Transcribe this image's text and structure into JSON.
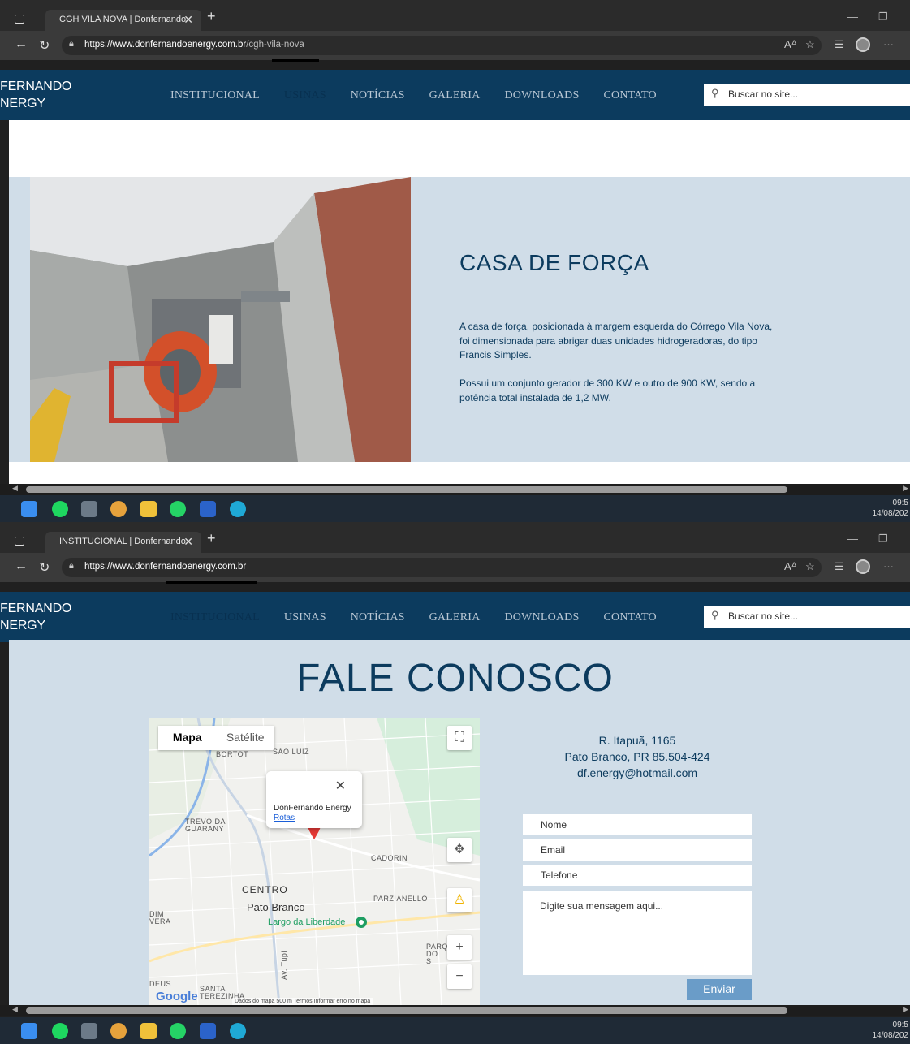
{
  "screen1": {
    "tab_title": "CGH VILA NOVA | Donfernando",
    "url_host": "https://www.donfernandoenergy.com.br",
    "url_path": "/cgh-vila-nova",
    "site": {
      "logo_line1": "FERNANDO",
      "logo_line2": "NERGY",
      "menu": [
        "INSTITUCIONAL",
        "USINAS",
        "NOTÍCIAS",
        "GALERIA",
        "DOWNLOADS",
        "CONTATO"
      ],
      "active_menu": "USINAS",
      "search_placeholder": "Buscar no site..."
    },
    "section": {
      "title": "CASA DE FORÇA",
      "paragraph1": "A casa de força, posicionada à margem esquerda do Córrego Vila Nova, foi dimensionada para abrigar duas unidades hidrogeradoras, do tipo Francis Simples.",
      "paragraph2": "Possui um conjunto gerador de 300 KW e outro de 900 KW, sendo a potência total instalada de 1,2 MW."
    },
    "clock_time": "09:5",
    "clock_date": "14/08/202"
  },
  "screen2": {
    "tab_title": "INSTITUCIONAL | Donfernando",
    "url_host": "https://www.donfernandoenergy.com.br",
    "url_path": "",
    "site": {
      "logo_line1": "FERNANDO",
      "logo_line2": "NERGY",
      "menu": [
        "INSTITUCIONAL",
        "USINAS",
        "NOTÍCIAS",
        "GALERIA",
        "DOWNLOADS",
        "CONTATO"
      ],
      "active_menu": "INSTITUCIONAL",
      "search_placeholder": "Buscar no site..."
    },
    "contact": {
      "title": "FALE CONOSCO",
      "address_line1": "R. Itapuã,  1165",
      "address_line2": "Pato Branco, PR 85.504-424",
      "email": "df.energy@hotmail.com",
      "field_name": "Nome",
      "field_email": "Email",
      "field_phone": "Telefone",
      "field_message": "Digite sua mensagem aqui...",
      "submit": "Enviar"
    },
    "map": {
      "tab_map": "Mapa",
      "tab_satellite": "Satélite",
      "popup_title": "DonFernando Energy",
      "popup_link": "Rotas",
      "labels": [
        "BORTOT",
        "SÃO LUIZ",
        "TREVO DA GUARANY",
        "CADORIN",
        "CENTRO",
        "Pato Branco",
        "Largo da Liberdade",
        "PARZIANELLO",
        "PARQ DO S",
        "DIM VERA",
        "DEUS",
        "SANTA TEREZINHA",
        "Av. Tupi"
      ],
      "brand": "Google",
      "footer": "Dados do mapa   500 m              Termos   Informar erro no mapa"
    },
    "clock_time": "09:5",
    "clock_date": "14/08/202"
  }
}
